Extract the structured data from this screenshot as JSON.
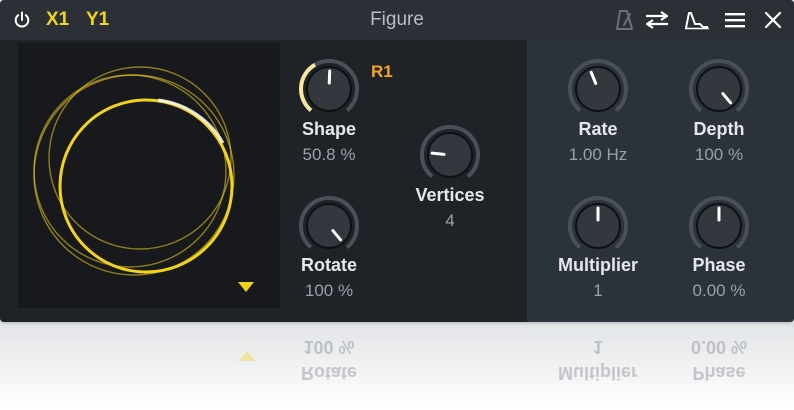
{
  "titlebar": {
    "title": "Figure",
    "x_label": "X1",
    "y_label": "Y1"
  },
  "display": {
    "badge": "R1"
  },
  "knobs": {
    "shape": {
      "label": "Shape",
      "value": "50.8 %",
      "level": 0.508
    },
    "rotate": {
      "label": "Rotate",
      "value": "100 %",
      "level": 1.0
    },
    "vertices": {
      "label": "Vertices",
      "value": "4",
      "level": 0.2
    },
    "rate": {
      "label": "Rate",
      "value": "1.00 Hz",
      "level": 0.42
    },
    "depth": {
      "label": "Depth",
      "value": "100 %",
      "level": 1.0
    },
    "multiplier": {
      "label": "Multiplier",
      "value": "1",
      "level": 0.5
    },
    "phase": {
      "label": "Phase",
      "value": "0.00 %",
      "level": 0.5
    }
  },
  "reflection": {
    "rotate_label": "Rotate",
    "rotate_value": "100 %",
    "multiplier_label": "Multiplier",
    "multiplier_value": "1",
    "phase_label": "Phase",
    "phase_value": "0.00 %"
  },
  "colors": {
    "accent_yellow": "#f2d31b",
    "badge_orange": "#f5a623",
    "knob_track": "#4a5059",
    "knob_fill": "#f5e6a0"
  },
  "icons": [
    "power-icon",
    "metronome-icon",
    "swap-arrows-icon",
    "envelope-icon",
    "menu-icon",
    "close-icon",
    "dropdown-triangle-icon"
  ]
}
